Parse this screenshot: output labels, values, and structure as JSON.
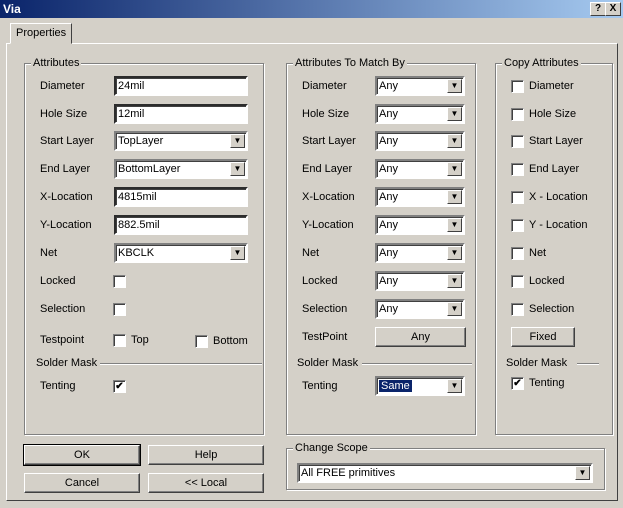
{
  "window": {
    "title": "Via",
    "help_btn": "?",
    "close_btn": "X"
  },
  "tab": "Properties",
  "attributes": {
    "title": "Attributes",
    "diameter_label": "Diameter",
    "diameter": "24mil",
    "hole_label": "Hole Size",
    "hole": "12mil",
    "start_label": "Start Layer",
    "start": "TopLayer",
    "end_label": "End Layer",
    "end": "BottomLayer",
    "x_label": "X-Location",
    "x": "4815mil",
    "y_label": "Y-Location",
    "y": "882.5mil",
    "net_label": "Net",
    "net": "KBCLK",
    "locked_label": "Locked",
    "selection_label": "Selection",
    "testpoint_label": "Testpoint",
    "top_label": "Top",
    "bottom_label": "Bottom",
    "solder_mask": "Solder Mask",
    "tenting_label": "Tenting",
    "tenting_check": "✔"
  },
  "match": {
    "title": "Attributes To Match By",
    "labels": [
      "Diameter",
      "Hole Size",
      "Start Layer",
      "End Layer",
      "X-Location",
      "Y-Location",
      "Net",
      "Locked",
      "Selection"
    ],
    "value": "Any",
    "testpoint_label": "TestPoint",
    "testpoint_btn": "Any",
    "solder_mask": "Solder Mask",
    "tenting_label": "Tenting",
    "tenting": "Same"
  },
  "copy": {
    "title": "Copy Attributes",
    "labels": [
      "Diameter",
      "Hole Size",
      "Start Layer",
      "End Layer",
      "X - Location",
      "Y - Location",
      "Net",
      "Locked",
      "Selection"
    ],
    "fixed_btn": "Fixed",
    "solder_mask": "Solder Mask",
    "tenting_label": "Tenting",
    "tenting_check": "✔"
  },
  "buttons": {
    "ok": "OK",
    "help": "Help",
    "cancel": "Cancel",
    "local": "<< Local"
  },
  "scope": {
    "title": "Change Scope",
    "value": "All FREE primitives"
  },
  "icons": {
    "arrow": "▼"
  }
}
